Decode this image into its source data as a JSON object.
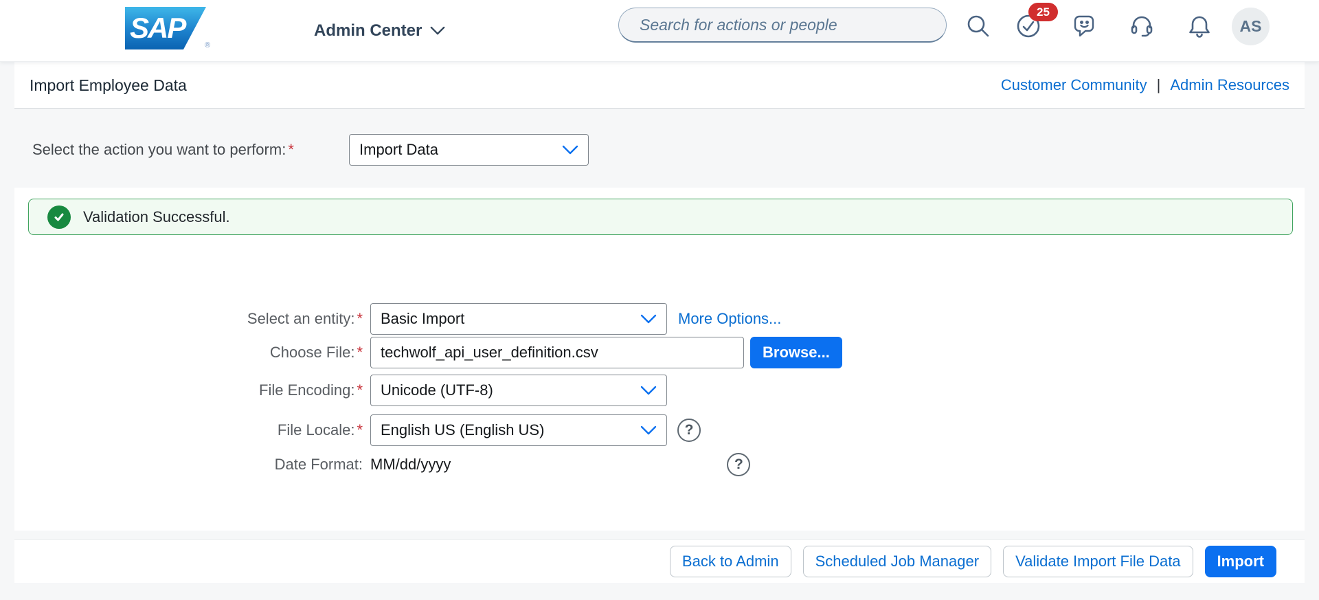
{
  "ui": {
    "required_marker": "*",
    "link_separator": "|"
  },
  "header": {
    "logo_text": "SAP",
    "logo_registered": "®",
    "nav_title": "Admin Center",
    "search_placeholder": "Search for actions or people",
    "notification_badge": "25",
    "avatar_initials": "AS",
    "icons": {
      "search": "search-icon",
      "todos": "check-circle-icon",
      "feedback": "chat-smiley-icon",
      "support": "headset-icon",
      "notifications": "bell-icon"
    }
  },
  "title_bar": {
    "title": "Import Employee Data",
    "link_customer_community": "Customer Community",
    "link_admin_resources": "Admin Resources"
  },
  "action_row": {
    "label": "Select the action you want to perform:",
    "value": "Import Data"
  },
  "banner": {
    "message": "Validation Successful."
  },
  "form": {
    "fields": [
      {
        "label": "Select an entity:",
        "value": "Basic Import",
        "link": "More Options..."
      },
      {
        "label": "Choose File:",
        "value": "techwolf_api_user_definition.csv",
        "button": "Browse..."
      },
      {
        "label": "File Encoding:",
        "value": "Unicode (UTF-8)"
      },
      {
        "label": "File Locale:",
        "value": "English US (English US)",
        "help": "?"
      },
      {
        "label": "Date Format:",
        "value": "MM/dd/yyyy",
        "help": "?"
      }
    ]
  },
  "footer": {
    "buttons": [
      {
        "label": "Back to Admin"
      },
      {
        "label": "Scheduled Job Manager"
      },
      {
        "label": "Validate Import File Data"
      },
      {
        "label": "Import"
      }
    ]
  },
  "colors": {
    "brand_blue": "#0b70f0",
    "link_blue": "#0a6ed1",
    "success_green": "#188940",
    "success_bg": "#f1faf2",
    "badge_red": "#d12e2e",
    "required_red": "#c8343c"
  }
}
